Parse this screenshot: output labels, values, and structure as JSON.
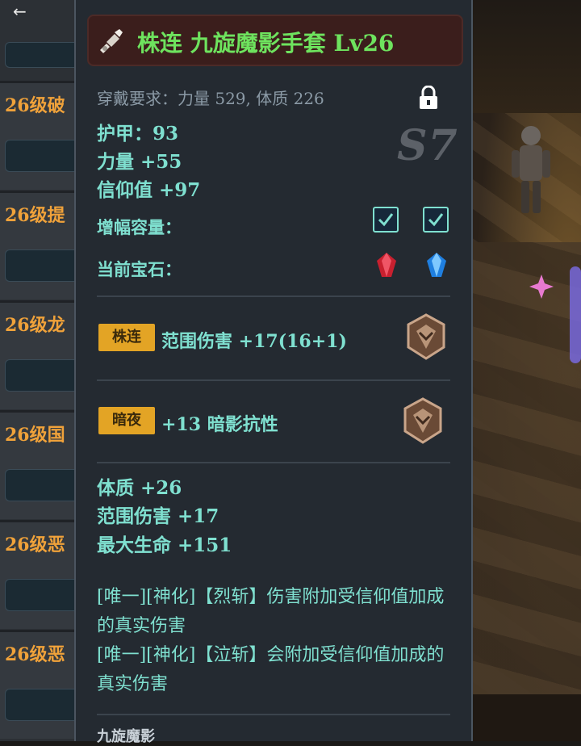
{
  "nav": {
    "back_icon": "←"
  },
  "left_list": {
    "items": [
      {
        "title": "26级破"
      },
      {
        "title": "26级提"
      },
      {
        "title": "26级龙"
      },
      {
        "title": "26级国"
      },
      {
        "title": "26级恶"
      },
      {
        "title": "26级恶"
      }
    ]
  },
  "item": {
    "name": "株连 九旋魔影手套 Lv26",
    "name_color": "#6ee35e",
    "icon": "gauntlet-icon",
    "requirement": "穿戴要求：力量 529, 体质 226",
    "lock_icon": "lock-icon",
    "tier": "S7",
    "base_stats": [
      "护甲：93",
      "力量 +55",
      "信仰值 +97"
    ],
    "capacity_label": "增幅容量：",
    "capacity_checks": [
      true,
      true
    ],
    "gems_label": "当前宝石：",
    "gems": [
      "red-gem-icon",
      "blue-gem-icon"
    ],
    "affixes": [
      {
        "tag": "株连",
        "text": "范围伤害 +17(16+1)",
        "icon": "bronze-shield-icon"
      },
      {
        "tag": "暗夜",
        "text": "+13 暗影抗性",
        "icon": "bronze-shield-icon"
      }
    ],
    "bonus_stats": [
      "体质 +26",
      "范围伤害 +17",
      "最大生命 +151"
    ],
    "descriptions": [
      "[唯一][神化]【烈斩】伤害附加受信仰值加成的真实伤害",
      "[唯一][神化]【泣斩】会附加受信仰值加成的真实伤害"
    ],
    "set_name": "九旋魔影"
  },
  "colors": {
    "accent": "#7fe0d0",
    "tag": "#e3a425",
    "list_title": "#f0a23a"
  }
}
